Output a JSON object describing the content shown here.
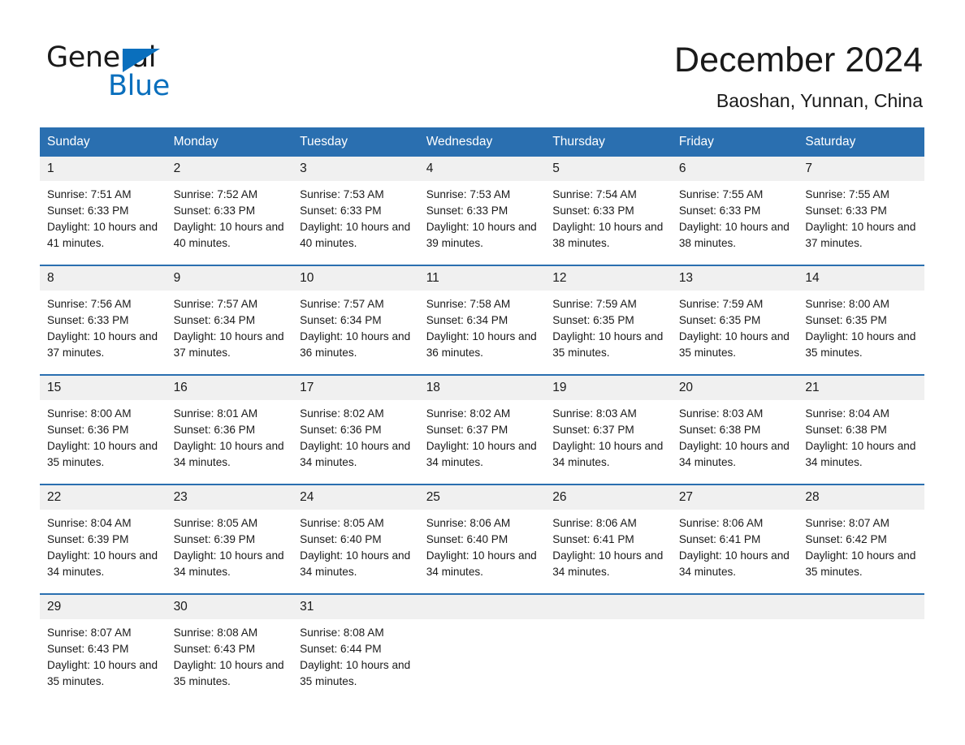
{
  "brand": {
    "name_part1": "General",
    "name_part2": "Blue",
    "triangle_icon": "triangle-icon",
    "accent_color": "#0a6fbd"
  },
  "header": {
    "title": "December 2024",
    "location": "Baoshan, Yunnan, China"
  },
  "colors": {
    "header_blue": "#2a6fb0",
    "daynum_gray": "#f0f0f0",
    "text": "#1a1a1a"
  },
  "calendar": {
    "weekday_headers": [
      "Sunday",
      "Monday",
      "Tuesday",
      "Wednesday",
      "Thursday",
      "Friday",
      "Saturday"
    ],
    "weeks": [
      [
        {
          "day": "1",
          "sunrise": "Sunrise: 7:51 AM",
          "sunset": "Sunset: 6:33 PM",
          "daylight": "Daylight: 10 hours and 41 minutes."
        },
        {
          "day": "2",
          "sunrise": "Sunrise: 7:52 AM",
          "sunset": "Sunset: 6:33 PM",
          "daylight": "Daylight: 10 hours and 40 minutes."
        },
        {
          "day": "3",
          "sunrise": "Sunrise: 7:53 AM",
          "sunset": "Sunset: 6:33 PM",
          "daylight": "Daylight: 10 hours and 40 minutes."
        },
        {
          "day": "4",
          "sunrise": "Sunrise: 7:53 AM",
          "sunset": "Sunset: 6:33 PM",
          "daylight": "Daylight: 10 hours and 39 minutes."
        },
        {
          "day": "5",
          "sunrise": "Sunrise: 7:54 AM",
          "sunset": "Sunset: 6:33 PM",
          "daylight": "Daylight: 10 hours and 38 minutes."
        },
        {
          "day": "6",
          "sunrise": "Sunrise: 7:55 AM",
          "sunset": "Sunset: 6:33 PM",
          "daylight": "Daylight: 10 hours and 38 minutes."
        },
        {
          "day": "7",
          "sunrise": "Sunrise: 7:55 AM",
          "sunset": "Sunset: 6:33 PM",
          "daylight": "Daylight: 10 hours and 37 minutes."
        }
      ],
      [
        {
          "day": "8",
          "sunrise": "Sunrise: 7:56 AM",
          "sunset": "Sunset: 6:33 PM",
          "daylight": "Daylight: 10 hours and 37 minutes."
        },
        {
          "day": "9",
          "sunrise": "Sunrise: 7:57 AM",
          "sunset": "Sunset: 6:34 PM",
          "daylight": "Daylight: 10 hours and 37 minutes."
        },
        {
          "day": "10",
          "sunrise": "Sunrise: 7:57 AM",
          "sunset": "Sunset: 6:34 PM",
          "daylight": "Daylight: 10 hours and 36 minutes."
        },
        {
          "day": "11",
          "sunrise": "Sunrise: 7:58 AM",
          "sunset": "Sunset: 6:34 PM",
          "daylight": "Daylight: 10 hours and 36 minutes."
        },
        {
          "day": "12",
          "sunrise": "Sunrise: 7:59 AM",
          "sunset": "Sunset: 6:35 PM",
          "daylight": "Daylight: 10 hours and 35 minutes."
        },
        {
          "day": "13",
          "sunrise": "Sunrise: 7:59 AM",
          "sunset": "Sunset: 6:35 PM",
          "daylight": "Daylight: 10 hours and 35 minutes."
        },
        {
          "day": "14",
          "sunrise": "Sunrise: 8:00 AM",
          "sunset": "Sunset: 6:35 PM",
          "daylight": "Daylight: 10 hours and 35 minutes."
        }
      ],
      [
        {
          "day": "15",
          "sunrise": "Sunrise: 8:00 AM",
          "sunset": "Sunset: 6:36 PM",
          "daylight": "Daylight: 10 hours and 35 minutes."
        },
        {
          "day": "16",
          "sunrise": "Sunrise: 8:01 AM",
          "sunset": "Sunset: 6:36 PM",
          "daylight": "Daylight: 10 hours and 34 minutes."
        },
        {
          "day": "17",
          "sunrise": "Sunrise: 8:02 AM",
          "sunset": "Sunset: 6:36 PM",
          "daylight": "Daylight: 10 hours and 34 minutes."
        },
        {
          "day": "18",
          "sunrise": "Sunrise: 8:02 AM",
          "sunset": "Sunset: 6:37 PM",
          "daylight": "Daylight: 10 hours and 34 minutes."
        },
        {
          "day": "19",
          "sunrise": "Sunrise: 8:03 AM",
          "sunset": "Sunset: 6:37 PM",
          "daylight": "Daylight: 10 hours and 34 minutes."
        },
        {
          "day": "20",
          "sunrise": "Sunrise: 8:03 AM",
          "sunset": "Sunset: 6:38 PM",
          "daylight": "Daylight: 10 hours and 34 minutes."
        },
        {
          "day": "21",
          "sunrise": "Sunrise: 8:04 AM",
          "sunset": "Sunset: 6:38 PM",
          "daylight": "Daylight: 10 hours and 34 minutes."
        }
      ],
      [
        {
          "day": "22",
          "sunrise": "Sunrise: 8:04 AM",
          "sunset": "Sunset: 6:39 PM",
          "daylight": "Daylight: 10 hours and 34 minutes."
        },
        {
          "day": "23",
          "sunrise": "Sunrise: 8:05 AM",
          "sunset": "Sunset: 6:39 PM",
          "daylight": "Daylight: 10 hours and 34 minutes."
        },
        {
          "day": "24",
          "sunrise": "Sunrise: 8:05 AM",
          "sunset": "Sunset: 6:40 PM",
          "daylight": "Daylight: 10 hours and 34 minutes."
        },
        {
          "day": "25",
          "sunrise": "Sunrise: 8:06 AM",
          "sunset": "Sunset: 6:40 PM",
          "daylight": "Daylight: 10 hours and 34 minutes."
        },
        {
          "day": "26",
          "sunrise": "Sunrise: 8:06 AM",
          "sunset": "Sunset: 6:41 PM",
          "daylight": "Daylight: 10 hours and 34 minutes."
        },
        {
          "day": "27",
          "sunrise": "Sunrise: 8:06 AM",
          "sunset": "Sunset: 6:41 PM",
          "daylight": "Daylight: 10 hours and 34 minutes."
        },
        {
          "day": "28",
          "sunrise": "Sunrise: 8:07 AM",
          "sunset": "Sunset: 6:42 PM",
          "daylight": "Daylight: 10 hours and 35 minutes."
        }
      ],
      [
        {
          "day": "29",
          "sunrise": "Sunrise: 8:07 AM",
          "sunset": "Sunset: 6:43 PM",
          "daylight": "Daylight: 10 hours and 35 minutes."
        },
        {
          "day": "30",
          "sunrise": "Sunrise: 8:08 AM",
          "sunset": "Sunset: 6:43 PM",
          "daylight": "Daylight: 10 hours and 35 minutes."
        },
        {
          "day": "31",
          "sunrise": "Sunrise: 8:08 AM",
          "sunset": "Sunset: 6:44 PM",
          "daylight": "Daylight: 10 hours and 35 minutes."
        },
        {
          "day": "",
          "sunrise": "",
          "sunset": "",
          "daylight": ""
        },
        {
          "day": "",
          "sunrise": "",
          "sunset": "",
          "daylight": ""
        },
        {
          "day": "",
          "sunrise": "",
          "sunset": "",
          "daylight": ""
        },
        {
          "day": "",
          "sunrise": "",
          "sunset": "",
          "daylight": ""
        }
      ]
    ]
  }
}
